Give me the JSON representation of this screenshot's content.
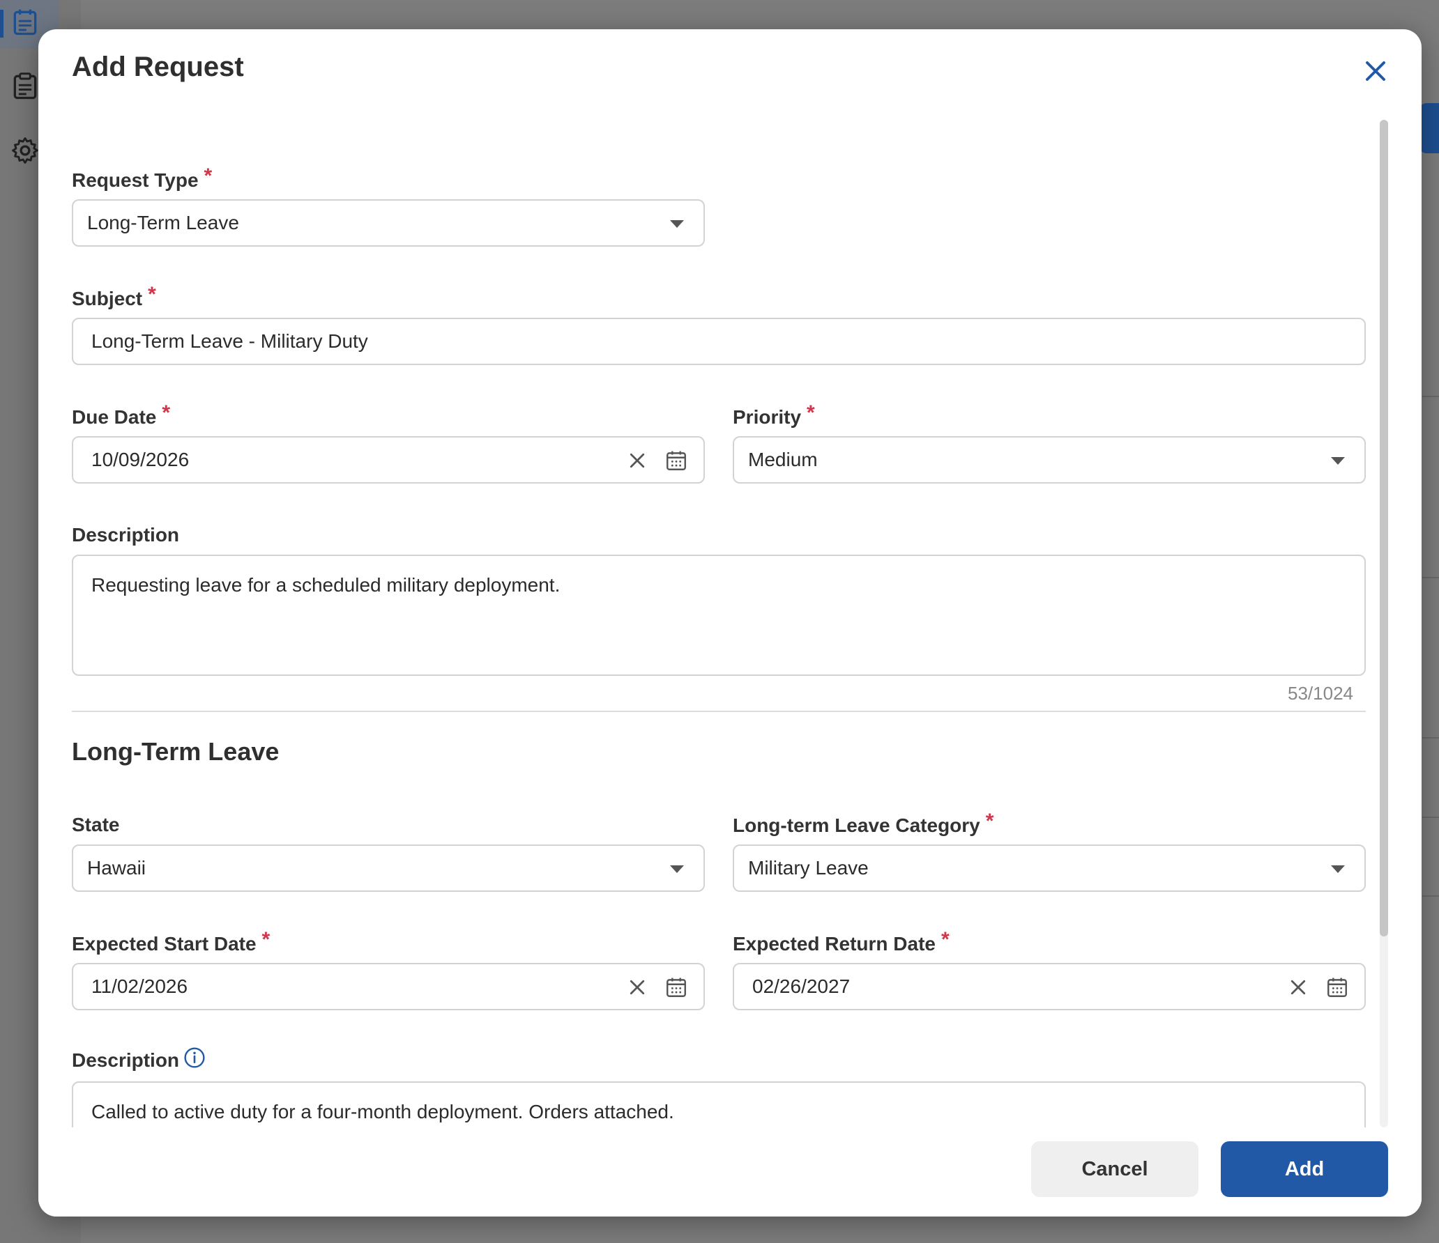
{
  "colors": {
    "primary": "#2159a6",
    "required": "#d3354b",
    "border": "#d3d3d3",
    "overlay": "#7a7a7a"
  },
  "modal": {
    "title": "Add Request",
    "close_icon": "close-icon"
  },
  "form": {
    "request_type": {
      "label": "Request Type",
      "required": "*",
      "value": "Long-Term Leave"
    },
    "subject": {
      "label": "Subject",
      "required": "*",
      "value": "Long-Term Leave - Military Duty"
    },
    "due_date": {
      "label": "Due Date",
      "required": "*",
      "value": "10/09/2026"
    },
    "priority": {
      "label": "Priority",
      "required": "*",
      "value": "Medium"
    },
    "description": {
      "label": "Description",
      "value": "Requesting leave for a scheduled military deployment.",
      "counter": "53/1024"
    }
  },
  "leave_section": {
    "title": "Long-Term Leave",
    "state": {
      "label": "State",
      "value": "Hawaii"
    },
    "category": {
      "label": "Long-term Leave Category",
      "required": "*",
      "value": "Military Leave"
    },
    "start_date": {
      "label": "Expected Start Date",
      "required": "*",
      "value": "11/02/2026"
    },
    "return_date": {
      "label": "Expected Return Date",
      "required": "*",
      "value": "02/26/2027"
    },
    "description": {
      "label": "Description",
      "value": "Called to active duty for a four-month deployment. Orders attached."
    }
  },
  "footer": {
    "cancel_label": "Cancel",
    "add_label": "Add"
  }
}
